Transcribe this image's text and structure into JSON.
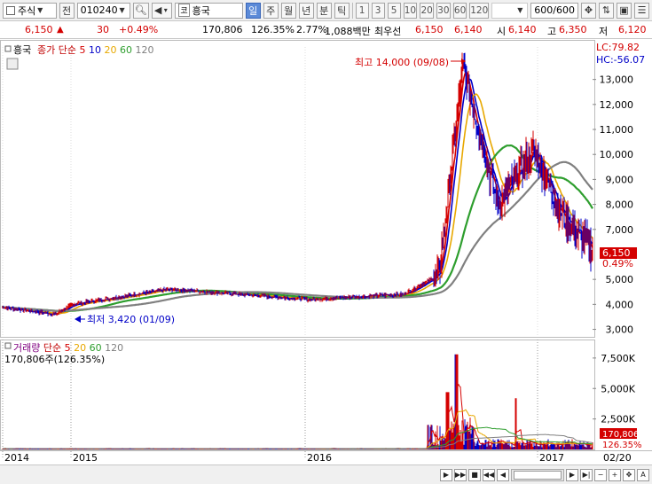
{
  "toolbar": {
    "market_type": "주식",
    "prev_label": "전",
    "stock_code": "010240",
    "exchange_badge": "코",
    "stock_name": "흥국",
    "period_tabs": [
      "일",
      "주",
      "월",
      "년",
      "분",
      "틱"
    ],
    "active_period": "일",
    "interval_buttons": [
      "1",
      "3",
      "5",
      "10",
      "20",
      "30",
      "60",
      "120"
    ],
    "count_display": "600/600"
  },
  "quote": {
    "price": "6,150",
    "change_arrow": "▲",
    "change": "30",
    "change_pct": "+0.49%",
    "volume": "170,806",
    "volume_ratio": "126.35%",
    "turnover": "2.77%",
    "amount": "1,088백만",
    "best_label": "최우선",
    "best_ask": "6,150",
    "best_bid": "6,140",
    "open_label": "시",
    "open": "6,140",
    "high_label": "고",
    "high": "6,350",
    "low_label": "저",
    "low": "6,120"
  },
  "price_panel": {
    "stock_name": "흥국",
    "ma_label": "종가 단순",
    "ma_periods": [
      "5",
      "10",
      "20",
      "60",
      "120"
    ],
    "ma_colors": [
      "#d40000",
      "#0000c8",
      "#e8a800",
      "#2e9e2e",
      "#808080"
    ],
    "lc_text": "LC:79.82",
    "hc_text": "HC:-56.07",
    "max_annotation": "최고 14,000 (09/08)",
    "min_annotation": "최저 3,420 (01/09)",
    "current_price": "6,150",
    "current_pct": "0.49%",
    "yticks": [
      "13,000",
      "12,000",
      "11,000",
      "10,000",
      "9,000",
      "8,000",
      "7,000",
      "5,000",
      "4,000",
      "3,000"
    ]
  },
  "volume_panel": {
    "title": "거래량",
    "ma_label": "단순",
    "ma_periods": [
      "5",
      "20",
      "60",
      "120"
    ],
    "ma_colors": [
      "#d40000",
      "#e8a800",
      "#2e9e2e",
      "#808080"
    ],
    "value_text": "170,806주(126.35%)",
    "current_volume": "170,806",
    "current_pct": "126.35%",
    "yticks": [
      "7,500K",
      "5,000K",
      "2,500K"
    ]
  },
  "xaxis": {
    "labels": [
      "2014",
      "2015",
      "2016",
      "2017"
    ],
    "right_label": "02/20"
  },
  "chart_data": {
    "type": "line",
    "title": "흥국",
    "series": [
      {
        "name": "종가",
        "x": [
          "2014-01",
          "2014-06",
          "2015-01",
          "2015-06",
          "2015-09",
          "2016-01",
          "2016-06",
          "2016-08",
          "2016-09",
          "2016-10",
          "2016-12",
          "2017-01",
          "2017-02"
        ],
        "values": [
          3900,
          3600,
          4000,
          4600,
          4500,
          4200,
          4400,
          5200,
          13500,
          8000,
          10200,
          7500,
          6150
        ]
      }
    ],
    "ylim": [
      2700,
      14300
    ]
  }
}
